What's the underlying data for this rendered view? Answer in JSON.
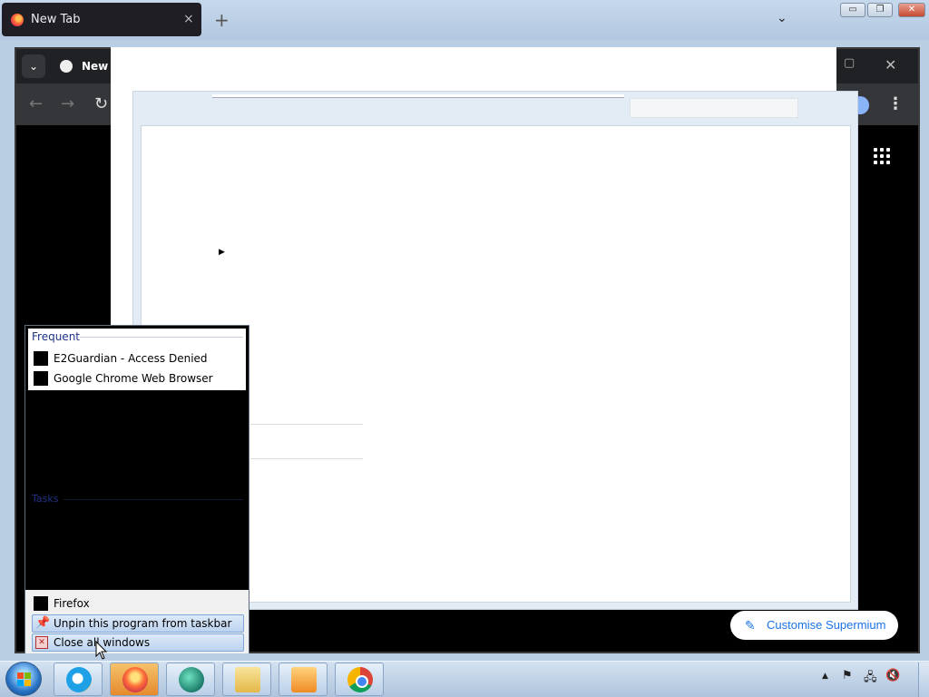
{
  "firefox": {
    "tab_title": "New Tab",
    "tab_close": "×",
    "new_tab": "+",
    "list_all_tabs": "⌄",
    "window_min": "▭",
    "window_max": "❐",
    "window_close": "✕"
  },
  "chromium": {
    "tab_search": "⌄",
    "tab_title": "New Tab",
    "maximize": "▢",
    "close": "✕",
    "back": "←",
    "forward": "→",
    "reload": "↻",
    "menu": "⋮",
    "customise_icon": "✎",
    "customise_label": "Customise Supermium"
  },
  "dialog": {
    "arrow": "▶"
  },
  "jumplist": {
    "frequent_header": "Frequent",
    "frequent_items": [
      {
        "label": "E2Guardian - Access Denied"
      },
      {
        "label": "Google Chrome Web Browser"
      }
    ],
    "tasks_header": "Tasks",
    "app_name": "Firefox",
    "unpin_label": "Unpin this program from taskbar",
    "close_all_label": "Close all windows"
  },
  "taskbar": {
    "tray_up": "▲",
    "tray_flag": "⚑",
    "tray_network": "🖧",
    "tray_sound_muted": "🔇"
  },
  "colors": {
    "accent_link": "#1a73e8",
    "jumplist_header": "#1e3287",
    "taskbar_bg": "#b9cde3"
  }
}
